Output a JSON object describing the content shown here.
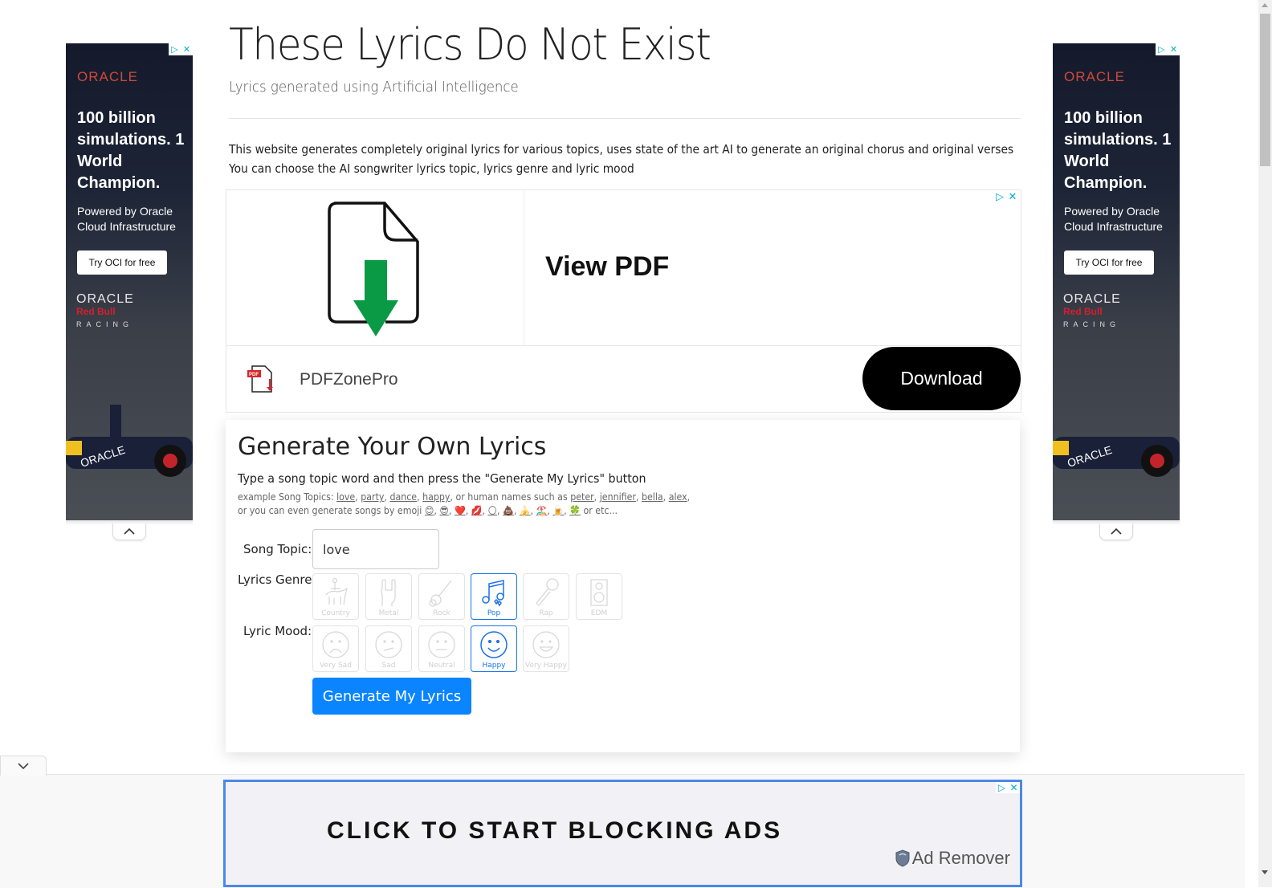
{
  "header": {
    "title": "These Lyrics Do Not Exist",
    "subtitle": "Lyrics generated using Artificial Intelligence",
    "description_line1": "This website generates completely original lyrics for various topics, uses state of the art AI to generate an original chorus and original verses",
    "description_line2": "You can choose the AI songwriter lyrics topic, lyrics genre and lyric mood"
  },
  "side_ads": {
    "brand": "ORACLE",
    "headline": "100 billion simulations. 1 World Champion.",
    "sub": "Powered by Oracle Cloud Infrastructure",
    "cta": "Try OCI for free",
    "brand2": "ORACLE",
    "redbull": "Red Bull",
    "racing": "RACING",
    "adchoices_icon": "▷",
    "close_icon": "✕"
  },
  "pdf_ad": {
    "headline": "View PDF",
    "brand": "PDFZonePro",
    "cta": "Download",
    "adchoices_icon": "▷",
    "close_icon": "✕"
  },
  "generator": {
    "title": "Generate Your Own Lyrics",
    "instructions": "Type a song topic word and then press the \"Generate My Lyrics\" button",
    "examples_prefix": "example Song Topics: ",
    "example_topics": [
      "love",
      "party",
      "dance",
      "happy"
    ],
    "names_prefix": ", or human names such as ",
    "example_names": [
      "peter",
      "jennifier",
      "bella",
      "alex"
    ],
    "emoji_prefix": "or you can even generate songs by emoji ",
    "example_emoji": [
      "😊",
      "😎",
      "❤️",
      "💋",
      "🌕",
      "💩",
      "🍌",
      "🏖️",
      "🍺",
      "🍀"
    ],
    "emoji_suffix": " or etc...",
    "topic_label": "Song Topic:",
    "topic_value": "love",
    "genre_label": "Lyrics Genre:",
    "genres": [
      {
        "label": "Country",
        "selected": false
      },
      {
        "label": "Metal",
        "selected": false
      },
      {
        "label": "Rock",
        "selected": false
      },
      {
        "label": "Pop",
        "selected": true
      },
      {
        "label": "Rap",
        "selected": false
      },
      {
        "label": "EDM",
        "selected": false
      }
    ],
    "mood_label": "Lyric Mood:",
    "moods": [
      {
        "label": "Very Sad",
        "selected": false
      },
      {
        "label": "Sad",
        "selected": false
      },
      {
        "label": "Neutral",
        "selected": false
      },
      {
        "label": "Happy",
        "selected": true
      },
      {
        "label": "Very Happy",
        "selected": false
      }
    ],
    "submit_label": "Generate My Lyrics"
  },
  "bottom_ad": {
    "headline": "CLICK TO START BLOCKING ADS",
    "brand": "Ad Remover",
    "adchoices_icon": "▷",
    "close_icon": "✕"
  },
  "colors": {
    "accent": "#0a84ff",
    "selected_border": "#1a73e8",
    "oracle_red": "#d0493a",
    "ad_border": "#4a89e8",
    "download_green": "#0a9a45"
  }
}
